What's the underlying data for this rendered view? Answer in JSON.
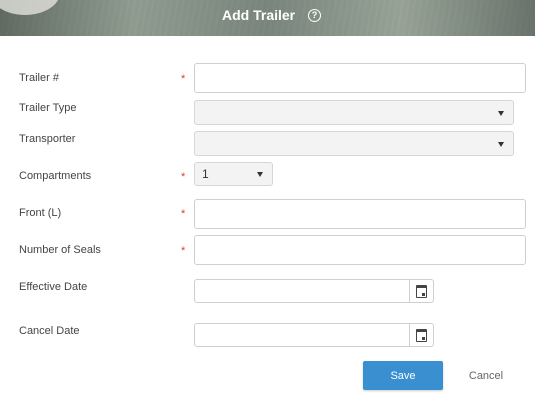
{
  "header": {
    "title": "Add Trailer",
    "help_icon": "question-circle-icon"
  },
  "form": {
    "trailer_number": {
      "label": "Trailer #",
      "required": "*",
      "value": ""
    },
    "trailer_type": {
      "label": "Trailer Type",
      "value": ""
    },
    "transporter": {
      "label": "Transporter",
      "value": ""
    },
    "compartments": {
      "label": "Compartments",
      "required": "*",
      "value": "1"
    },
    "front": {
      "label": "Front (L)",
      "required": "*",
      "value": ""
    },
    "number_of_seals": {
      "label": "Number of Seals",
      "required": "*",
      "value": ""
    },
    "effective_date": {
      "label": "Effective Date",
      "value": ""
    },
    "cancel_date": {
      "label": "Cancel Date",
      "value": ""
    }
  },
  "actions": {
    "save_label": "Save",
    "cancel_label": "Cancel"
  },
  "colors": {
    "primary": "#3a8fd0",
    "required": "#e03a3a"
  }
}
